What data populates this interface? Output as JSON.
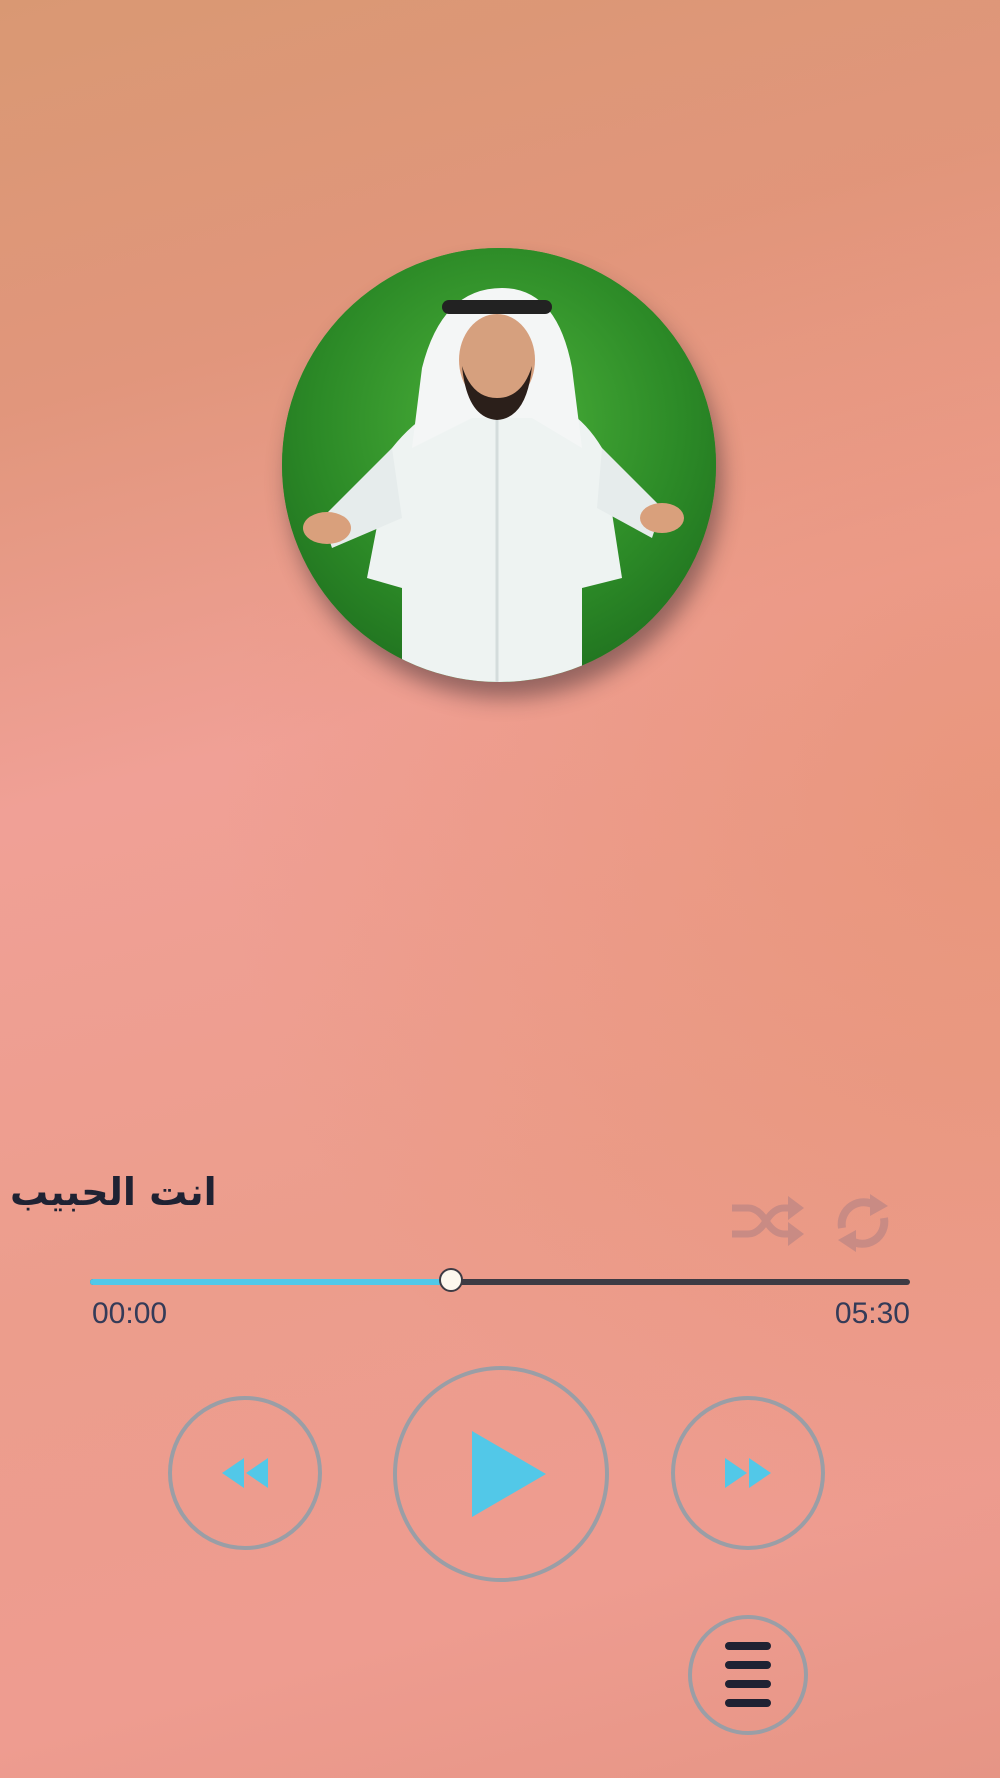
{
  "track": {
    "title": "انت الحبيب",
    "artwork": "artist-portrait"
  },
  "player": {
    "elapsed": "00:00",
    "duration": "05:30",
    "progress": 0.44,
    "shuffle_icon": "shuffle-icon",
    "repeat_icon": "repeat-icon",
    "rewind_icon": "rewind-icon",
    "play_icon": "play-icon",
    "forward_icon": "fast-forward-icon",
    "menu_icon": "menu-icon"
  },
  "colors": {
    "accent": "#52c8e8",
    "text": "#1f2233",
    "icon_muted": "#c98b84",
    "button_border": "#9a9ea6"
  }
}
